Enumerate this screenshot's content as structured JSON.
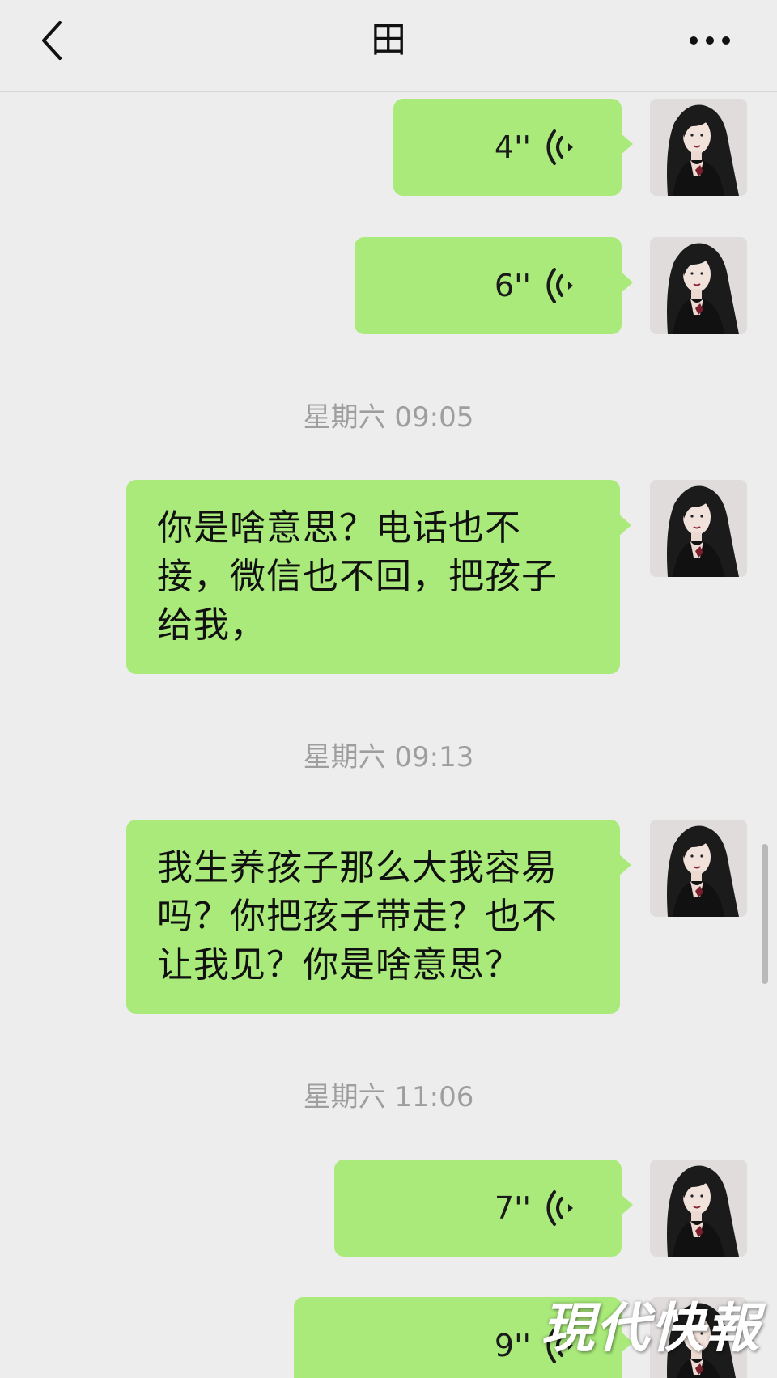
{
  "nav": {
    "title": "田",
    "back_icon": "chevron-left-icon",
    "more_icon": "more-dots-icon"
  },
  "messages": [
    {
      "type": "voice",
      "duration": "4''",
      "sender": "self"
    },
    {
      "type": "voice",
      "duration": "6''",
      "sender": "self"
    },
    {
      "type": "time",
      "text": "星期六 09:05"
    },
    {
      "type": "text",
      "text": "你是啥意思？电话也不接，微信也不回，把孩子给我，",
      "sender": "self"
    },
    {
      "type": "time",
      "text": "星期六 09:13"
    },
    {
      "type": "text",
      "text": "我生养孩子那么大我容易吗？你把孩子带走？也不让我见？你是啥意思？",
      "sender": "self"
    },
    {
      "type": "time",
      "text": "星期六 11:06"
    },
    {
      "type": "voice",
      "duration": "7''",
      "sender": "self"
    },
    {
      "type": "voice",
      "duration": "9''",
      "sender": "self"
    }
  ],
  "watermark": "現代快報",
  "colors": {
    "background": "#ededed",
    "bubble_self": "#a9ea7a",
    "timestamp": "#9e9e9e"
  }
}
